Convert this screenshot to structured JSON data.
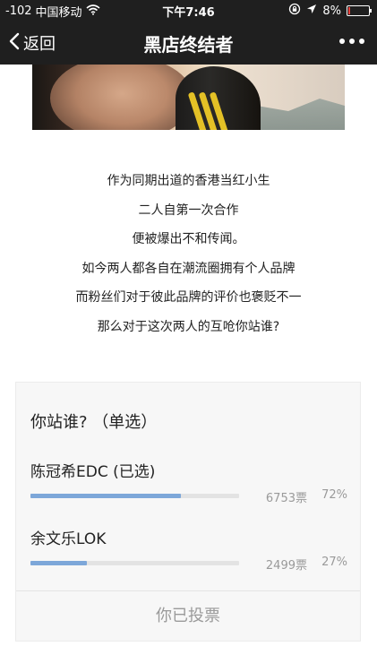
{
  "status_bar": {
    "signal": "-102",
    "carrier": "中国移动",
    "time": "下午7:46",
    "battery": "8%",
    "battery_level": 0.08
  },
  "nav": {
    "back_label": "返回",
    "title": "黑店终结者"
  },
  "article": {
    "lines": [
      "作为同期出道的香港当红小生",
      "二人自第一次合作",
      "便被爆出不和传闻。",
      "如今两人都各自在潮流圈拥有个人品牌",
      "而粉丝们对于彼此品牌的评价也褒贬不一",
      "那么对于这次两人的互呛你站谁?"
    ]
  },
  "vote": {
    "question": "你站谁? （单选）",
    "options": [
      {
        "label": "陈冠希EDC (已选)",
        "count": "6753票",
        "percent": "72%",
        "ratio": 0.72
      },
      {
        "label": "余文乐LOK",
        "count": "2499票",
        "percent": "27%",
        "ratio": 0.27
      }
    ],
    "voted_label": "你已投票"
  },
  "colors": {
    "bar_fill": "#7da7d9",
    "bar_track": "#e3e3e3",
    "header_bg": "#1f1f1f",
    "battery_low": "#e8413c"
  }
}
